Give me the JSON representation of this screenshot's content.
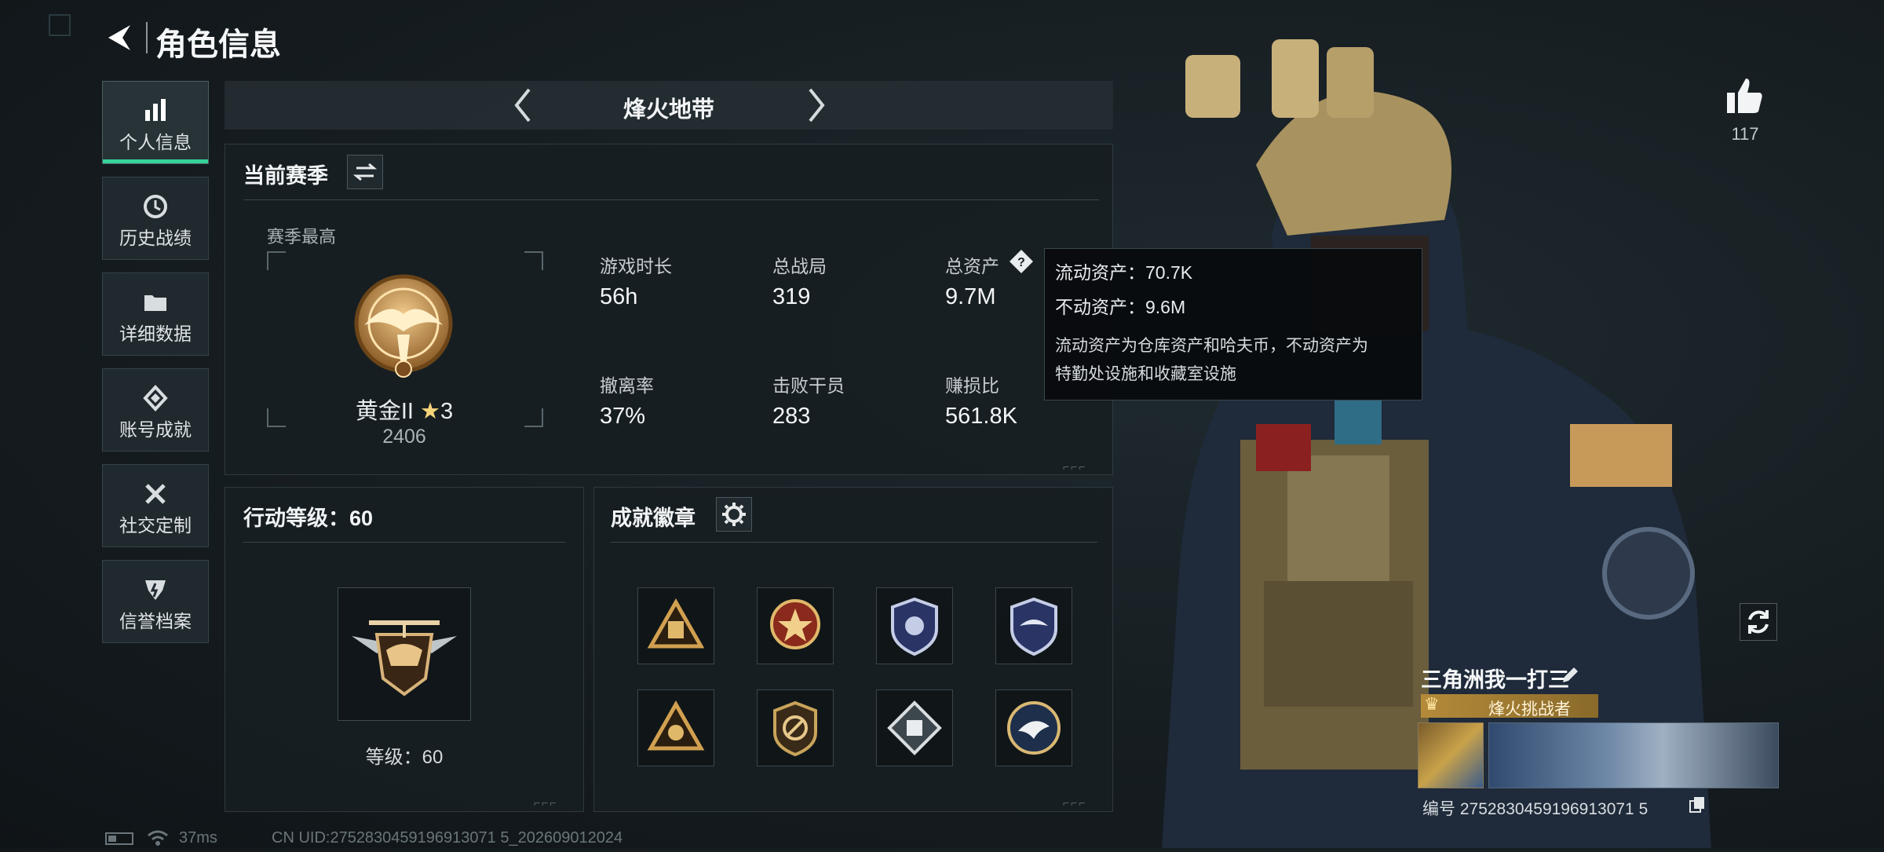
{
  "header": {
    "title": "角色信息"
  },
  "sidebar": {
    "items": [
      {
        "label": "个人信息",
        "icon": "bar-chart-icon",
        "active": true
      },
      {
        "label": "历史战绩",
        "icon": "clock-history-icon",
        "active": false
      },
      {
        "label": "详细数据",
        "icon": "folder-icon",
        "active": false
      },
      {
        "label": "账号成就",
        "icon": "achievement-icon",
        "active": false
      },
      {
        "label": "社交定制",
        "icon": "tools-icon",
        "active": false
      },
      {
        "label": "信誉档案",
        "icon": "credit-shield-icon",
        "active": false
      }
    ]
  },
  "mode_selector": {
    "label": "烽火地带"
  },
  "season": {
    "title": "当前赛季",
    "highest_label": "赛季最高",
    "rank_name": "黄金II",
    "rank_star_icon": "star-icon",
    "rank_stars": "3",
    "rank_score": "2406",
    "stats": [
      {
        "label": "游戏时长",
        "value": "56h"
      },
      {
        "label": "总战局",
        "value": "319"
      },
      {
        "label": "总资产",
        "value": "9.7M"
      },
      {
        "label": "撤离率",
        "value": "37%"
      },
      {
        "label": "击败干员",
        "value": "283"
      },
      {
        "label": "赚损比",
        "value": "561.8K"
      }
    ]
  },
  "tooltip": {
    "liquid": "流动资产：70.7K",
    "fixed": "不动资产：9.6M",
    "desc_line1": "流动资产为仓库资产和哈夫币，不动资产为",
    "desc_line2": "特勤处设施和收藏室设施"
  },
  "action_level": {
    "title": "行动等级：60",
    "level_label": "等级：60"
  },
  "achievements": {
    "title": "成就徽章",
    "count": 8
  },
  "profile": {
    "likes": "117",
    "player_name": "三角洲我一打三",
    "title_badge": "烽火挑战者",
    "id_line": "编号 2752830459196913071 5"
  },
  "status_bar": {
    "ping": "37ms",
    "uid": "CN UID:2752830459196913071 5_202609012024"
  },
  "colors": {
    "accent": "#35d39b",
    "gold": "#c9a45a",
    "panel": "#171e22"
  }
}
